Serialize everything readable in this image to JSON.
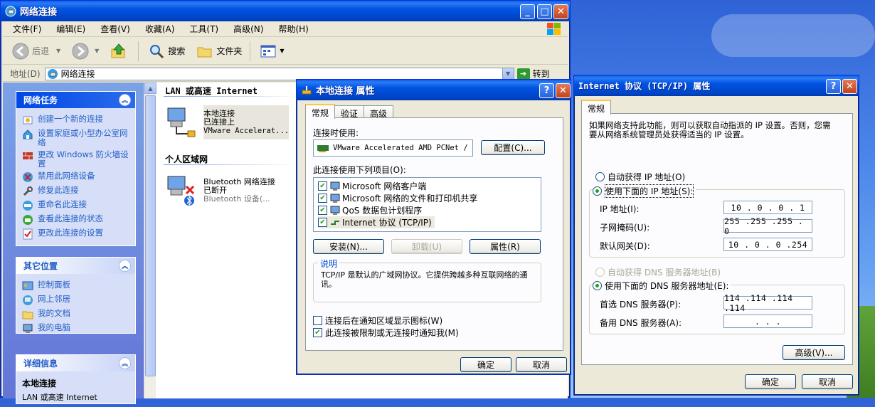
{
  "colors": {
    "titlebar": "#0053e1",
    "link": "#215dc6",
    "check": "#21a121"
  },
  "explorer": {
    "title": "网络连接",
    "menu": [
      "文件(F)",
      "编辑(E)",
      "查看(V)",
      "收藏(A)",
      "工具(T)",
      "高级(N)",
      "帮助(H)"
    ],
    "toolbar": {
      "back": "后退",
      "search": "搜索",
      "folders": "文件夹"
    },
    "address": {
      "label": "地址(D)",
      "value": "网络连接",
      "go": "转到"
    },
    "tasks": {
      "network": {
        "title": "网络任务",
        "items": [
          "创建一个新的连接",
          "设置家庭或小型办公室网络",
          "更改 Windows 防火墙设置",
          "禁用此网络设备",
          "修复此连接",
          "重命名此连接",
          "查看此连接的状态",
          "更改此连接的设置"
        ]
      },
      "other": {
        "title": "其它位置",
        "items": [
          "控制面板",
          "网上邻居",
          "我的文档",
          "我的电脑"
        ]
      },
      "details": {
        "title": "详细信息",
        "name": "本地连接",
        "sub": "LAN 或高速 Internet"
      }
    },
    "groups": {
      "lan": "LAN 或高速 Internet",
      "pan": "个人区域网"
    },
    "connections": [
      {
        "name": "本地连接",
        "status": "已连接上",
        "device": "VMware Accelerat..."
      },
      {
        "name": "Bluetooth 网络连接",
        "status": "已断开",
        "device": "Bluetooth 设备(..."
      }
    ]
  },
  "props": {
    "title": "本地连接 属性",
    "tabs": [
      "常规",
      "验证",
      "高级"
    ],
    "connect_using_label": "连接时使用:",
    "adapter": "VMware Accelerated AMD PCNet /",
    "configure": "配置(C)...",
    "items_label": "此连接使用下列项目(O):",
    "items": [
      "Microsoft 网络客户端",
      "Microsoft 网络的文件和打印机共享",
      "QoS 数据包计划程序",
      "Internet 协议 (TCP/IP)"
    ],
    "install": "安装(N)...",
    "uninstall": "卸载(U)",
    "properties": "属性(R)",
    "desc_title": "说明",
    "desc_text": "TCP/IP 是默认的广域网协议。它提供跨越多种互联网络的通讯。",
    "show_icon": "连接后在通知区域显示图标(W)",
    "notify_limited": "此连接被限制或无连接时通知我(M)",
    "ok": "确定",
    "cancel": "取消"
  },
  "tcpip": {
    "title": "Internet 协议 (TCP/IP) 属性",
    "tab": "常规",
    "intro": "如果网络支持此功能，则可以获取自动指派的 IP 设置。否则，您需要从网络系统管理员处获得适当的 IP 设置。",
    "auto_ip": "自动获得 IP 地址(O)",
    "manual_ip": "使用下面的 IP 地址(S):",
    "ip_label": "IP 地址(I):",
    "ip": "10 . 0 . 0 . 1",
    "mask_label": "子网掩码(U):",
    "mask": "255 .255 .255 . 0",
    "gw_label": "默认网关(D):",
    "gw": "10 . 0 . 0 .254",
    "auto_dns": "自动获得 DNS 服务器地址(B)",
    "manual_dns": "使用下面的 DNS 服务器地址(E):",
    "dns1_label": "首选 DNS 服务器(P):",
    "dns1": "114 .114 .114 .114",
    "dns2_label": "备用 DNS 服务器(A):",
    "dns2": " .  .  . ",
    "advanced": "高级(V)...",
    "ok": "确定",
    "cancel": "取消"
  }
}
